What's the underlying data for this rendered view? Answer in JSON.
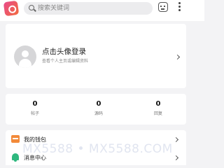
{
  "search": {
    "placeholder": "搜索关键词"
  },
  "profile": {
    "title": "点击头像登录",
    "subtitle": "查看个人主页或编辑资料"
  },
  "stats": [
    {
      "value": "0",
      "label": "帖子"
    },
    {
      "value": "0",
      "label": "源码"
    },
    {
      "value": "0",
      "label": "回复"
    }
  ],
  "menu": [
    {
      "label": "我的钱包",
      "icon": "wallet-icon"
    },
    {
      "label": "消息中心",
      "icon": "bell-icon"
    }
  ],
  "watermark": "MX5588 • MX5588.COM",
  "colors": {
    "logo": "#e84a8c",
    "wallet": "#f28a3a",
    "bell": "#2fb87f"
  }
}
